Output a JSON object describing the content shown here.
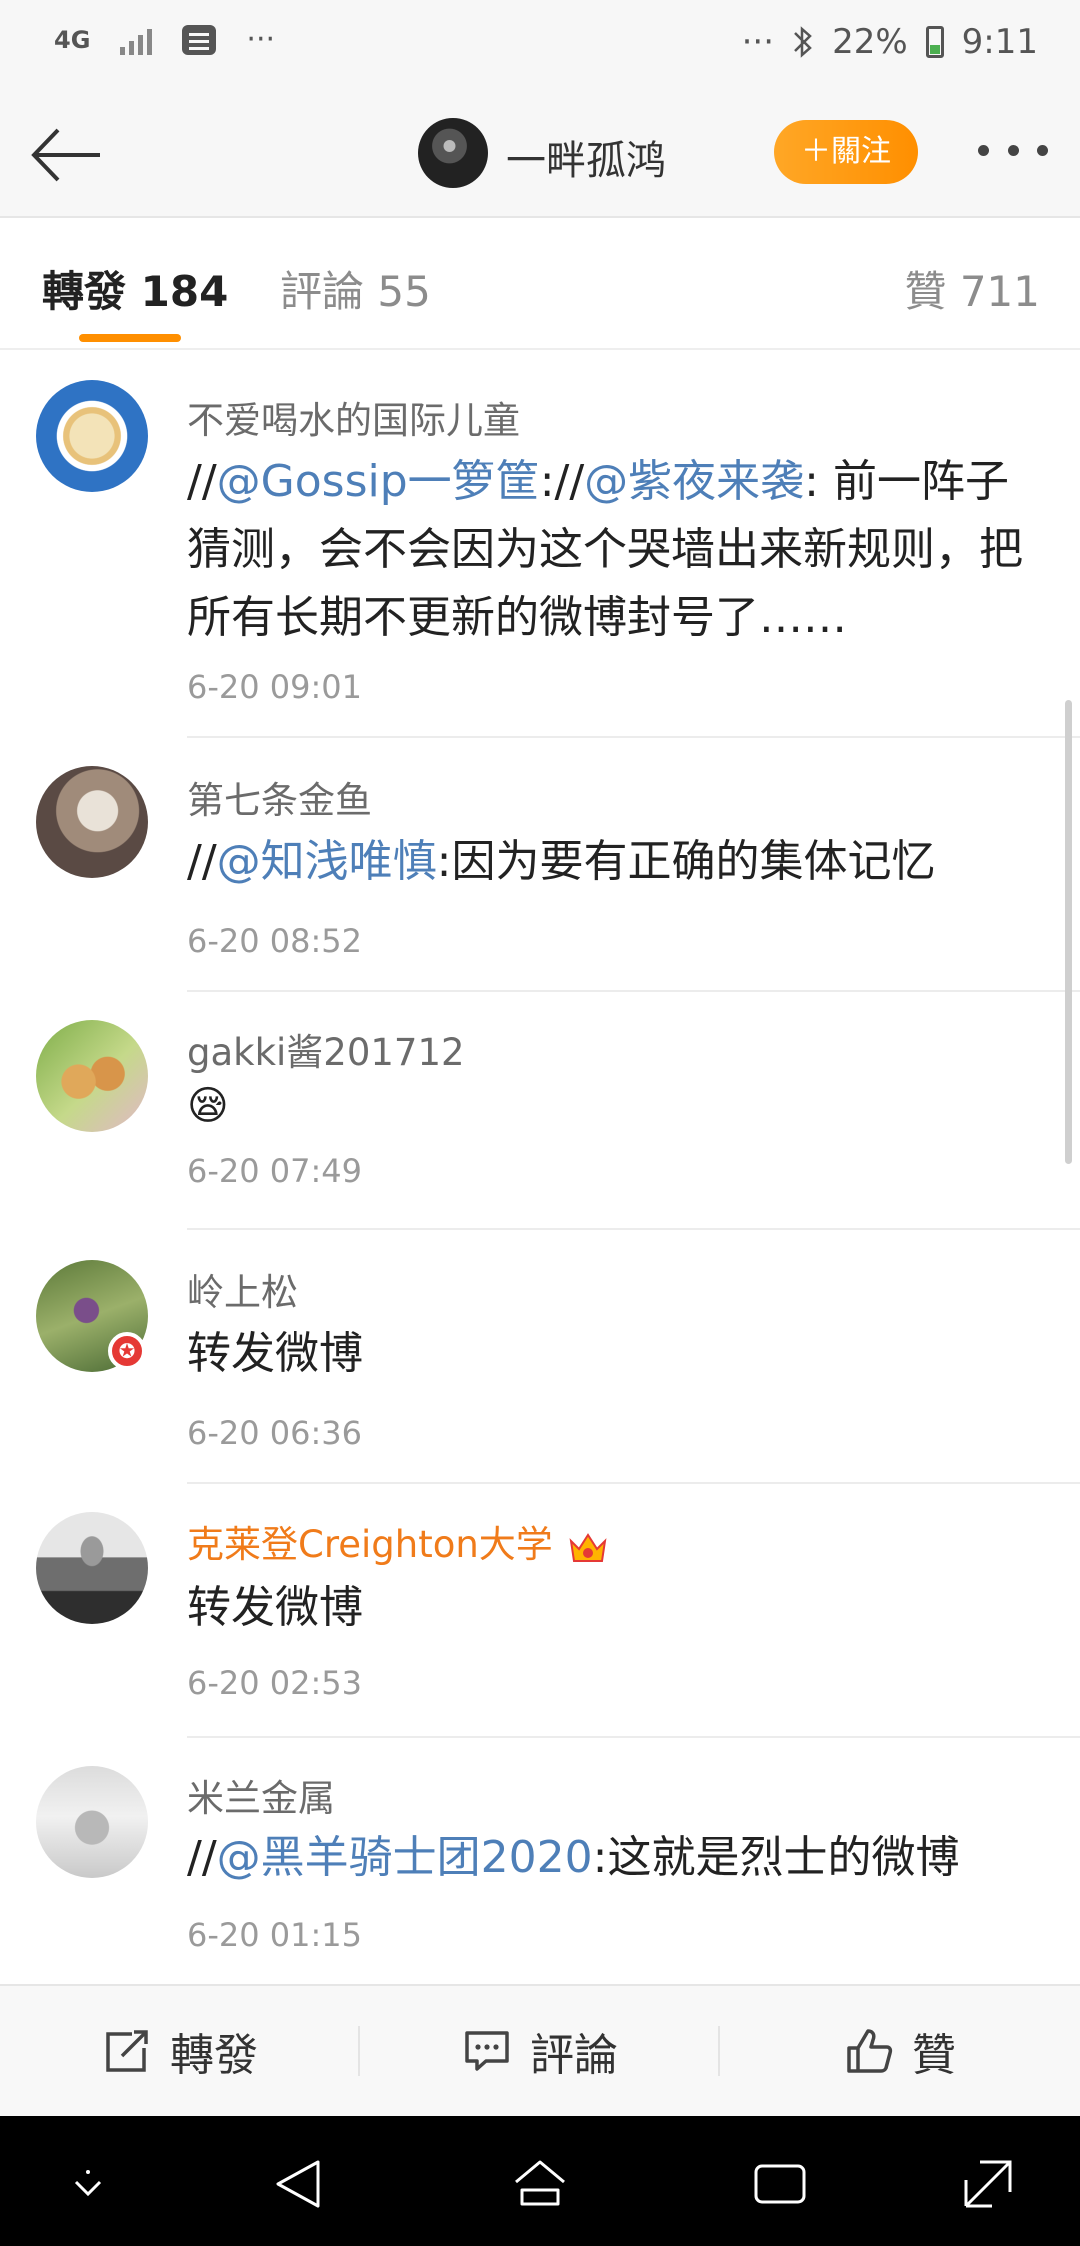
{
  "status_bar": {
    "network": "4G",
    "notification_dots": "···",
    "right_dots": "···",
    "battery": "22%",
    "time": "9:11"
  },
  "header": {
    "name": "一畔孤鸿",
    "follow_label": "＋關注"
  },
  "tabs": {
    "repost": "轉發 184",
    "comment": "評論 55",
    "like": "贊 711"
  },
  "reposts": [
    {
      "user": "不爱喝水的国际儿童",
      "content_parts": [
        "//",
        "@Gossip一箩筐",
        ":",
        "//",
        "@紫夜来袭",
        ": 前一阵子猜测，会不会因为这个哭墙出来新规则，把所有长期不更新的微博封号了……"
      ],
      "time": "6-20 09:01"
    },
    {
      "user": "第七条金鱼",
      "content_parts": [
        "//",
        "@知浅唯慎",
        ":因为要有正确的集体记忆"
      ],
      "time": "6-20 08:52"
    },
    {
      "user": "gakki酱201712",
      "content": "😪",
      "time": "6-20 07:49"
    },
    {
      "user": "岭上松",
      "content": "转发微博",
      "time": "6-20 06:36"
    },
    {
      "user": "克莱登Creighton大学",
      "content": "转发微博",
      "time": "6-20 02:53"
    },
    {
      "user": "米兰金属",
      "content_parts": [
        "//",
        "@黑羊骑士团2020",
        ":这就是烈士的微博"
      ],
      "time": "6-20 01:15"
    }
  ],
  "actions": {
    "repost": "轉發",
    "comment": "評論",
    "like": "贊"
  }
}
